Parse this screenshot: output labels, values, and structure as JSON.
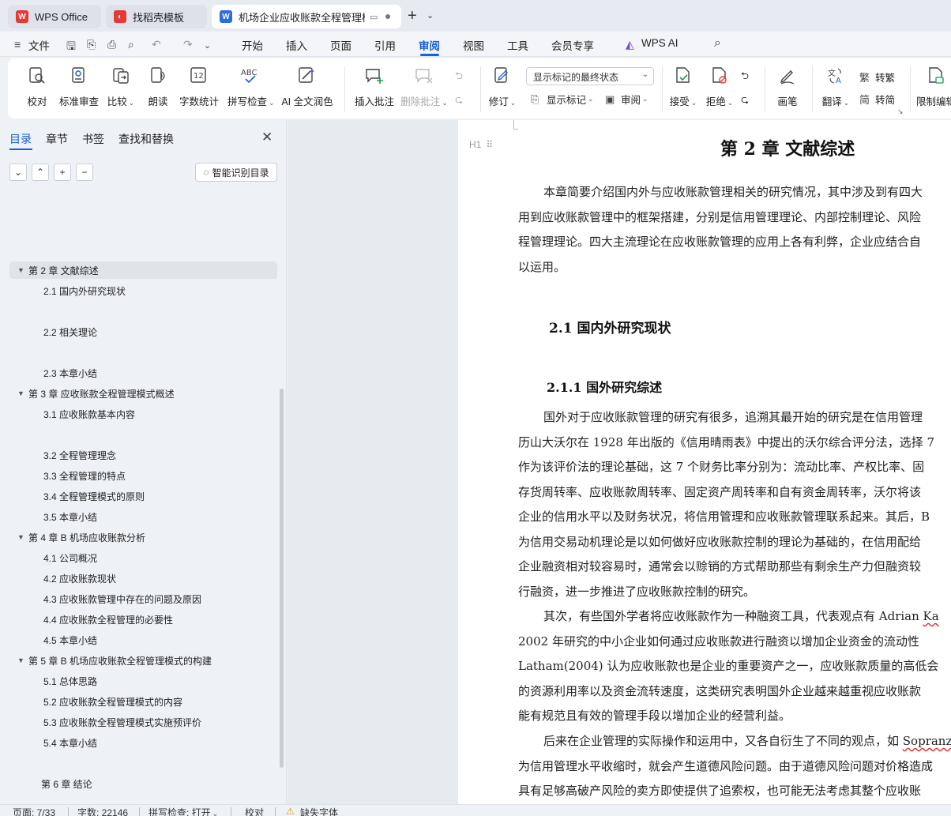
{
  "tabs": {
    "wps": "WPS Office",
    "template": "找稻壳模板",
    "doc": "机场企业应收账款全程管理模式"
  },
  "menu": {
    "file": "文件",
    "items": [
      "开始",
      "插入",
      "页面",
      "引用",
      "审阅",
      "视图",
      "工具",
      "会员专享"
    ],
    "active": "审阅",
    "ai": "WPS AI"
  },
  "ribbon": {
    "proofread": "校对",
    "standard_review": "标准审查",
    "compare": "比较",
    "read_aloud": "朗读",
    "word_count": "字数统计",
    "spell_check": "拼写检查",
    "ai_polish": "AI 全文润色",
    "insert_comment": "插入批注",
    "delete_comment": "删除批注",
    "revise": "修订",
    "markup_select": "显示标记的最终状态",
    "show_markup": "显示标记",
    "review": "审阅",
    "accept": "接受",
    "reject": "拒绝",
    "ink": "画笔",
    "translate": "翻译",
    "to_traditional": "转繁",
    "to_simplified": "转简",
    "restrict_edit": "限制编辑"
  },
  "nav": {
    "tabs": [
      "目录",
      "章节",
      "书签",
      "查找和替换"
    ],
    "active_tab": "目录",
    "smart_toc": "智能识别目录",
    "toc": [
      {
        "text": "第 2 章  文献综述",
        "level": 1,
        "expanded": true,
        "selected": true
      },
      {
        "text": "2.1 国内外研究现状",
        "level": 2
      },
      {
        "text": "2.2 相关理论",
        "level": 2
      },
      {
        "text": "2.3 本章小结",
        "level": 2
      },
      {
        "text": "第 3 章  应收账款全程管理模式概述",
        "level": 1,
        "expanded": true
      },
      {
        "text": "3.1 应收账款基本内容",
        "level": 2
      },
      {
        "text": "3.2 全程管理理念",
        "level": 2
      },
      {
        "text": "3.3 全程管理的特点",
        "level": 2
      },
      {
        "text": "3.4 全程管理模式的原则",
        "level": 2
      },
      {
        "text": "3.5 本章小结",
        "level": 2
      },
      {
        "text": "第 4 章  B 机场应收账款分析",
        "level": 1,
        "expanded": true
      },
      {
        "text": "4.1  公司概况",
        "level": 2
      },
      {
        "text": "4.2  应收账款现状",
        "level": 2
      },
      {
        "text": "4.3  应收账款管理中存在的问题及原因",
        "level": 2
      },
      {
        "text": "4.4  应收账款全程管理的必要性",
        "level": 2
      },
      {
        "text": "4.5  本章小结",
        "level": 2
      },
      {
        "text": "第 5 章 B 机场应收账款全程管理模式的构建",
        "level": 1,
        "expanded": true
      },
      {
        "text": "5.1  总体思路",
        "level": 2
      },
      {
        "text": "5.2  应收账款全程管理模式的内容",
        "level": 2
      },
      {
        "text": "5.3  应收账款全程管理模式实施预评价",
        "level": 2
      },
      {
        "text": "5.4  本章小结",
        "level": 2
      },
      {
        "text": "第 6 章  结论",
        "level": 1
      }
    ]
  },
  "doc": {
    "title": "第 2 章  文献综述",
    "h1_tag": "H1",
    "intro": [
      "本章简要介绍国内外与应收账款管理相关的研究情况，其中涉及到有四大",
      "用到应收账款管理中的框架搭建，分别是信用管理理论、内部控制理论、风险",
      "程管理理论。四大主流理论在应收账款管理的应用上各有利弊，企业应结合自",
      "以运用。"
    ],
    "h2": "2.1 国内外研究现状",
    "h3": "2.1.1 国外研究综述",
    "p1": [
      "国外对于应收账款管理的研究有很多，追溯其最开始的研究是在信用管理",
      "历山大沃尔在 1928 年出版的《信用晴雨表》中提出的沃尔综合评分法，选择 7",
      "作为该评价法的理论基础，这 7 个财务比率分别为：流动比率、产权比率、固",
      "存货周转率、应收账款周转率、固定资产周转率和自有资金周转率，沃尔将该",
      "企业的信用水平以及财务状况，将信用管理和应收账款管理联系起来。其后，B",
      "为信用交易动机理论是以如何做好应收账款控制的理论为基础的，在信用配给",
      "企业融资相对较容易时，通常会以赊销的方式帮助那些有剩余生产力但融资较",
      "行融资，进一步推进了应收账款控制的研究。"
    ],
    "p2_first_pre": "其次，有些国外学者将应收账款作为一种融资工具，代表观点有 Adrian ",
    "p2_first_sq": "Ka",
    "p2": [
      "2002  年研究的中小企业如何通过应收账款进行融资以增加企业资金的流动性",
      "Latham(2004) 认为应收账款也是企业的重要资产之一，应收账款质量的高低会",
      "的资源利用率以及资金流转速度，这类研究表明国外企业越来越重视应收账款",
      "能有规范且有效的管理手段以增加企业的经营利益。"
    ],
    "p3_first_pre": "后来在企业管理的实际操作和运用中，又各自衍生了不同的观点，如 ",
    "p3_first_sq": "Sopranz",
    "p3": [
      "为信用管理水平收缩时，就会产生道德风险问题。由于道德风险问题对价格造成",
      "具有足够高破产风险的卖方即使提供了追索权，也可能无法考虑其整个应收账"
    ]
  },
  "status": {
    "page": "页面: 7/33",
    "words": "字数: 22146",
    "spell": "拼写检查: 打开",
    "proof": "校对",
    "missing_font": "缺失字体"
  }
}
